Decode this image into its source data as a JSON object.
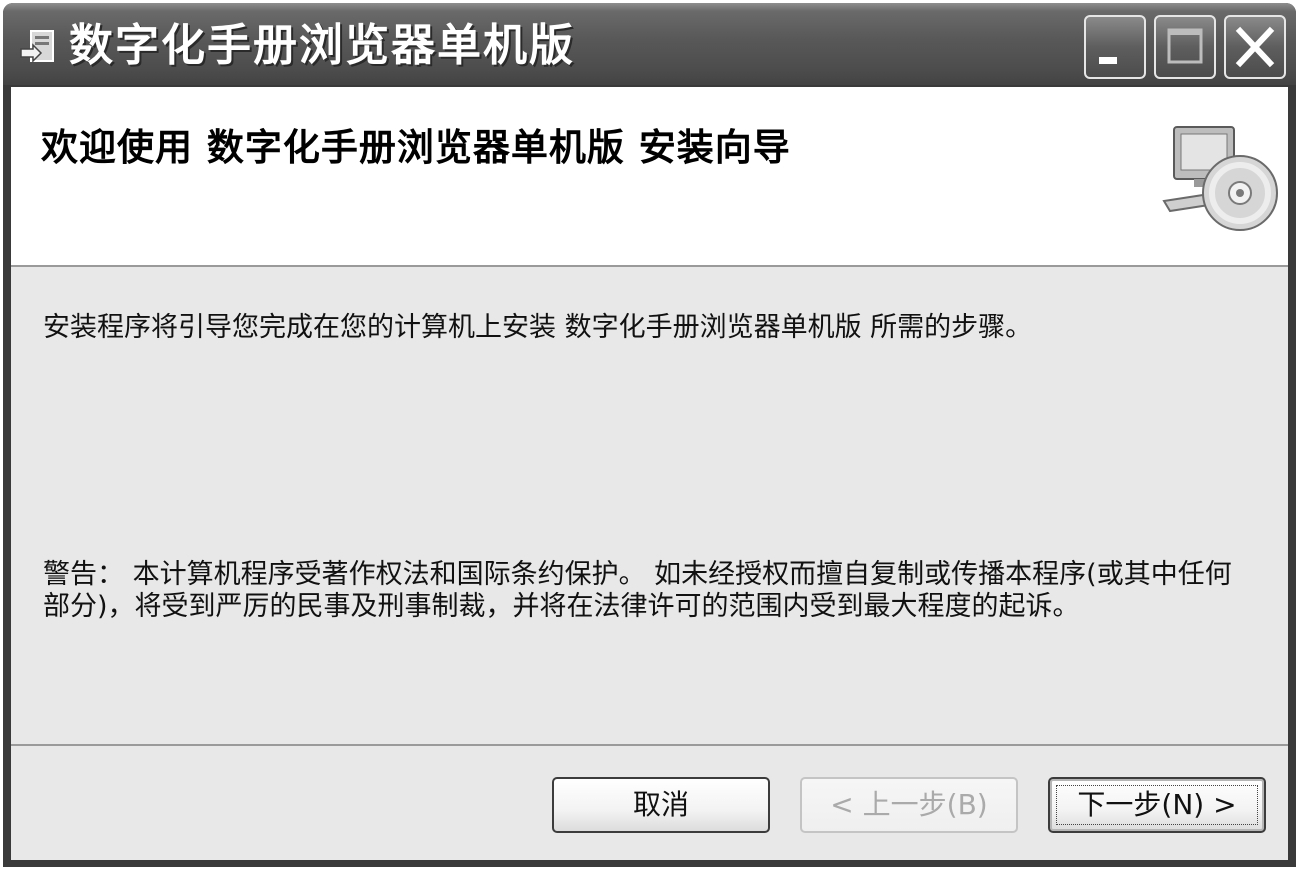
{
  "window": {
    "title": "数字化手册浏览器单机版",
    "icons": {
      "app": "installer-icon",
      "minimize": "minimize-icon",
      "maximize": "maximize-icon",
      "close": "close-icon"
    }
  },
  "banner": {
    "title": "欢迎使用 数字化手册浏览器单机版 安装向导",
    "icon": "computer-cd-icon"
  },
  "body": {
    "intro": "安装程序将引导您完成在您的计算机上安装 数字化手册浏览器单机版 所需的步骤。",
    "warning": "警告： 本计算机程序受著作权法和国际条约保护。 如未经授权而擅自复制或传播本程序(或其中任何部分)，将受到严厉的民事及刑事制裁，并将在法律许可的范围内受到最大程度的起诉。"
  },
  "buttons": {
    "cancel": "取消",
    "back": "< 上一步(B)",
    "next": "下一步(N) >",
    "back_enabled": false
  }
}
